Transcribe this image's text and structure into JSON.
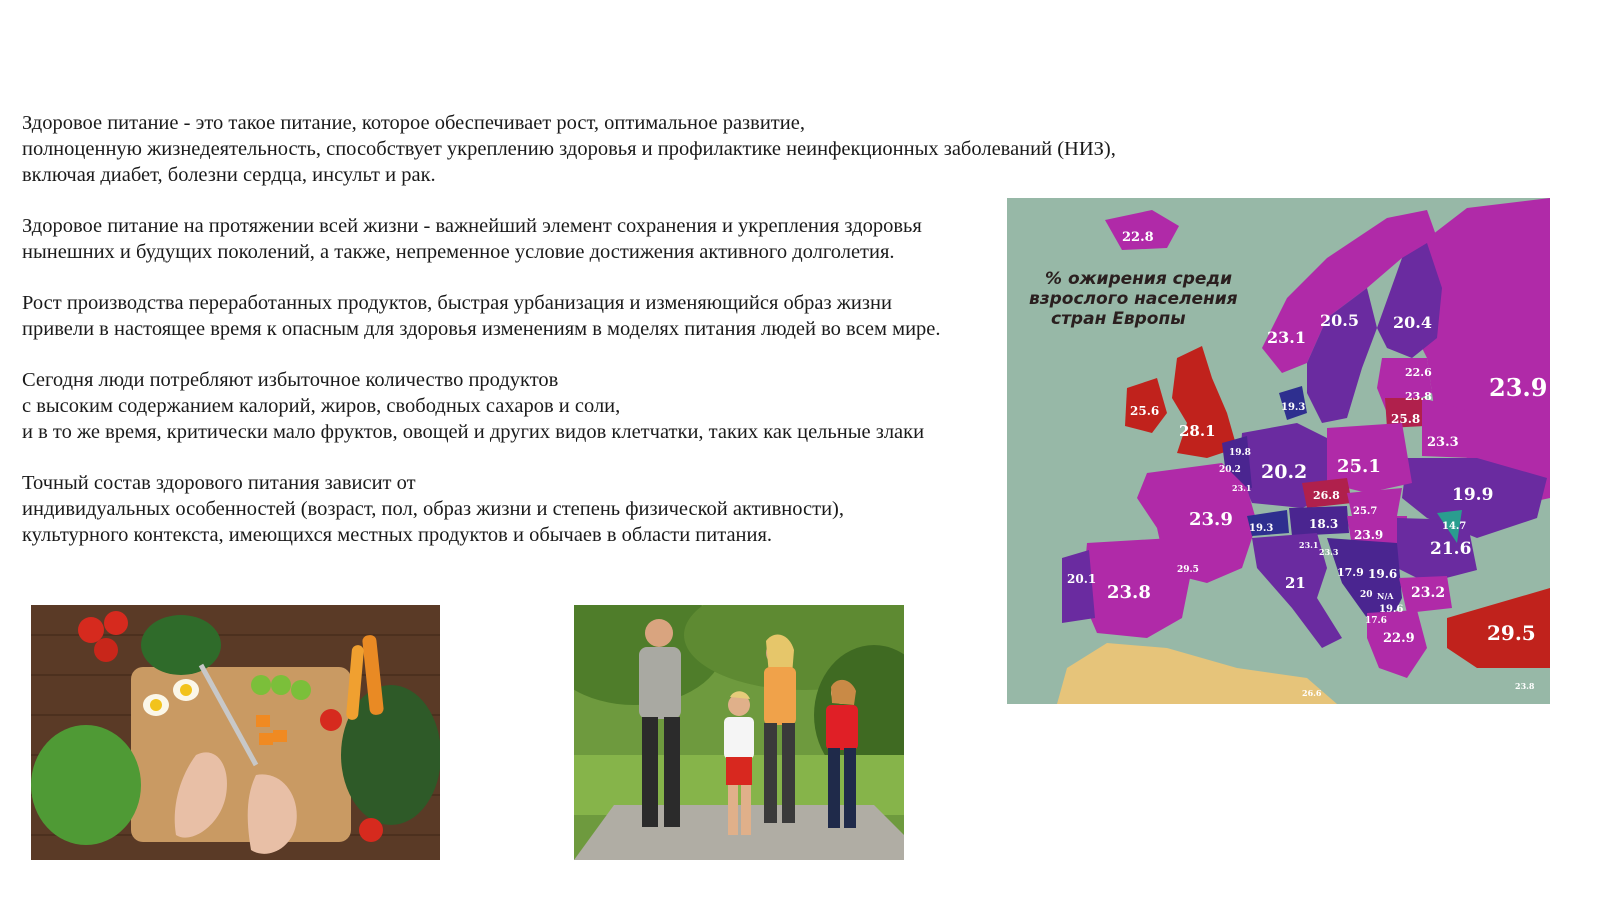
{
  "paragraphs": [
    {
      "lines": [
        "Здоровое питание - это такое питание, которое обеспечивает рост, оптимальное развитие,",
        "полноценную жизнедеятельность, способствует укреплению здоровья и профилактике неинфекционных заболеваний (НИЗ),",
        "включая диабет, болезни сердца, инсульт и рак."
      ]
    },
    {
      "lines": [
        "Здоровое питание на протяжении всей жизни - важнейший элемент сохранения и укрепления здоровья",
        "нынешних и будущих поколений, а также, непременное условие достижения активного долголетия."
      ]
    },
    {
      "lines": [
        "Рост производства переработанных продуктов, быстрая урбанизация и изменяющийся образ жизни",
        "привели в настоящее время к опасным для здоровья изменениям в моделях питания людей во всем мире."
      ]
    },
    {
      "lines": [
        "Сегодня люди потребляют избыточное количество продуктов",
        "с высоким содержанием калорий, жиров, свободных сахаров и соли,",
        "и в то же время, критически мало фруктов, овощей и других видов клетчатки, таких как цельные злаки"
      ]
    },
    {
      "lines": [
        "Точный состав здорового питания зависит от",
        "индивидуальных особенностей (возраст, пол, образ жизни и степень физической активности),",
        "культурного контекста, имеющихся местных продуктов и обычаев в области питания."
      ]
    }
  ],
  "map": {
    "title_lines": [
      "% ожирения среди",
      "взрослого населения",
      "стран Европы"
    ],
    "values": {
      "iceland": "22.8",
      "norway": "23.1",
      "sweden": "20.5",
      "finland": "20.4",
      "russia": "23.9",
      "estonia": "22.6",
      "latvia": "23.8",
      "lithuania": "25.8",
      "belarus": "23.3",
      "denmark": "19.3",
      "ireland": "25.6",
      "uk": "28.1",
      "netherlands": "19.8",
      "belgium": "20.2",
      "luxembourg": "23.1",
      "germany": "20.2",
      "poland": "25.1",
      "czechia": "26.8",
      "slovakia": "25.7",
      "ukraine": "19.9",
      "france": "23.9",
      "switzerland": "19.3",
      "austria": "18.3",
      "hungary": "23.9",
      "moldova": "14.7",
      "romania": "21.6",
      "slovenia": "23.1",
      "croatia": "23.3",
      "bosnia": "17.9",
      "serbia": "19.6",
      "montenegro": "20",
      "kosovo": "N/A",
      "macedonia": "19.6",
      "albania": "17.6",
      "bulgaria": "23.2",
      "italy": "21",
      "monaco": "29.5",
      "portugal": "20.1",
      "spain": "23.8",
      "greece": "22.9",
      "turkey": "29.5",
      "malta": "26.6",
      "cyprus": "23.8"
    }
  },
  "photos": {
    "vegetables": "vegetables-photo",
    "running": "running-family-photo"
  },
  "colors": {
    "sea": "#8fb2a0",
    "magenta": "#b02aa8",
    "purple": "#6a2ba0",
    "dark_purple": "#4a2590",
    "blue": "#2e2f8f",
    "crimson": "#b0204c",
    "red": "#c0221c",
    "sand": "#e6c47a"
  }
}
